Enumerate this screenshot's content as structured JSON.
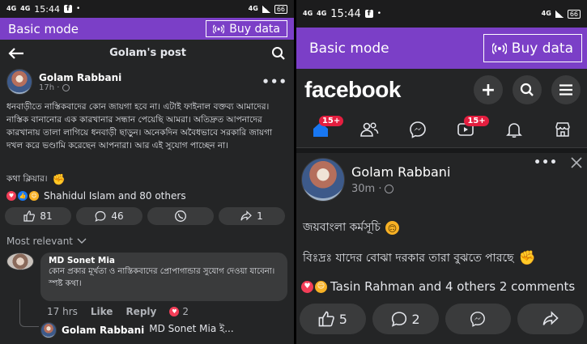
{
  "left": {
    "status": {
      "time": "15:44",
      "sig1": "4G",
      "sig2": "4G",
      "net": "4G",
      "battery": "66"
    },
    "mode": {
      "label": "Basic mode",
      "buy": "Buy data"
    },
    "header": {
      "title": "Golam's post"
    },
    "post": {
      "author": "Golam Rabbani",
      "time": "17h ·",
      "text": "ধনবাড়ীতে নাস্তিকবাদের কোন জায়গা হবে না। এটাই ফাইনাল বক্তব্য আমাদের। নাস্তিক বানানোর এক কারখানার সন্ধান পেয়েছি আমরা। অতিদ্রুত আপনাদের কারখানায় তালা লাগিয়ে ধনবাড়ী ছাড়ুন। অনেকদিন অবৈধভাবে সরকারি জায়গা দখল করে ভণ্ডামি করেছেন আপনারা। আর এই সুযোগ পাচ্ছেন না।",
      "text2": "কথা ক্লিয়ার।",
      "reactions": "Shahidul Islam and 80 others",
      "likes": "81",
      "comments": "46",
      "shares": "1"
    },
    "sort": "Most relevant",
    "comment": {
      "author": "MD Sonet Mia",
      "text": "কোন প্রকার মূর্খতা ও নাস্তিকবাদের প্রোপাগান্ডার সুযোগ দেওয়া যাবেনা। স্পষ্ট কথা।",
      "time": "17 hrs",
      "like": "Like",
      "reply": "Reply",
      "count": "2"
    },
    "reply": {
      "author": "Golam Rabbani",
      "text": "MD Sonet Mia ই..."
    }
  },
  "right": {
    "status": {
      "time": "15:44",
      "sig1": "4G",
      "sig2": "4G",
      "net": "4G",
      "battery": "66"
    },
    "mode": {
      "label": "Basic mode",
      "buy": "Buy data"
    },
    "logo": "facebook",
    "badges": {
      "home": "15+",
      "video": "15+"
    },
    "post": {
      "author": "Golam Rabbani",
      "time": "30m ·",
      "line1": "জয়বাংলা কর্মসূচি",
      "line2": "বিঃদ্রঃ যাদের বোঝা দরকার তারা বুঝতে পারছে",
      "reactions": "Tasin Rahman and 4 others 2 comments",
      "likes": "5",
      "comments": "2"
    }
  },
  "colors": {
    "accent": "#7b3fc7",
    "bg": "#242526",
    "fbblue": "#1877f2",
    "badge": "#e41e3f"
  }
}
